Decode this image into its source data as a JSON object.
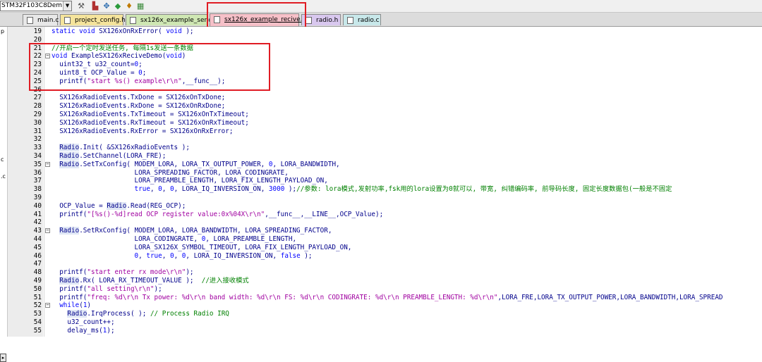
{
  "toolbar": {
    "target": "STM32F103C8Dem",
    "icons": [
      "wand-icon",
      "manage-icon",
      "component-icon",
      "diamond-icon",
      "download-icon",
      "chip-icon"
    ]
  },
  "tabs": [
    {
      "label": "main.c",
      "color": "#e8e8e8",
      "active": false
    },
    {
      "label": "project_config.h",
      "color": "#f5e49c",
      "active": false
    },
    {
      "label": "sx126x_example_send.c",
      "color": "#cfe7b3",
      "active": false
    },
    {
      "label": "sx126x_example_recive.c",
      "color": "#f6c0c8",
      "active": true
    },
    {
      "label": "radio.h",
      "color": "#d9c8ef",
      "active": false
    },
    {
      "label": "radio.c",
      "color": "#c8e8ea",
      "active": false
    }
  ],
  "sidebar": {
    "fragments": [
      "p",
      "c",
      ".c"
    ],
    "scroll_arrow": "▸"
  },
  "code_lines": [
    {
      "n": "19",
      "fold": "",
      "segs": [
        [
          "k",
          "static void "
        ],
        [
          "i",
          "SX126xOnRxError( "
        ],
        [
          "k",
          "void"
        ],
        [
          "i",
          " );"
        ]
      ]
    },
    {
      "n": "20",
      "fold": "",
      "segs": []
    },
    {
      "n": "21",
      "fold": "",
      "segs": [
        [
          "c",
          "//开启一个定时发送任务, 每隔1s发送一条数据"
        ]
      ]
    },
    {
      "n": "22",
      "fold": "⊟",
      "segs": [
        [
          "k",
          "void "
        ],
        [
          "i",
          "ExampleSX126xReciveDemo("
        ],
        [
          "k",
          "void"
        ],
        [
          "i",
          ")"
        ]
      ]
    },
    {
      "n": "23",
      "fold": "",
      "segs": [
        [
          "i",
          "  uint32_t u32_count="
        ],
        [
          "n",
          "0"
        ],
        [
          "i",
          ";"
        ]
      ]
    },
    {
      "n": "24",
      "fold": "",
      "segs": [
        [
          "i",
          "  uint8_t OCP_Value = "
        ],
        [
          "n",
          "0"
        ],
        [
          "i",
          ";"
        ]
      ]
    },
    {
      "n": "25",
      "fold": "",
      "segs": [
        [
          "i",
          "  printf("
        ],
        [
          "s",
          "\"start %s() example\\r\\n\""
        ],
        [
          "i",
          ",__func__);"
        ]
      ]
    },
    {
      "n": "26",
      "fold": "",
      "segs": []
    },
    {
      "n": "27",
      "fold": "",
      "segs": [
        [
          "i",
          "  SX126xRadioEvents.TxDone = SX126xOnTxDone;"
        ]
      ]
    },
    {
      "n": "28",
      "fold": "",
      "segs": [
        [
          "i",
          "  SX126xRadioEvents.RxDone = SX126xOnRxDone;"
        ]
      ]
    },
    {
      "n": "29",
      "fold": "",
      "segs": [
        [
          "i",
          "  SX126xRadioEvents.TxTimeout = SX126xOnTxTimeout;"
        ]
      ]
    },
    {
      "n": "30",
      "fold": "",
      "segs": [
        [
          "i",
          "  SX126xRadioEvents.RxTimeout = SX126xOnRxTimeout;"
        ]
      ]
    },
    {
      "n": "31",
      "fold": "",
      "segs": [
        [
          "i",
          "  SX126xRadioEvents.RxError = SX126xOnRxError;"
        ]
      ]
    },
    {
      "n": "32",
      "fold": "",
      "segs": []
    },
    {
      "n": "33",
      "fold": "",
      "segs": [
        [
          "i",
          "  "
        ],
        [
          "o",
          "Radio"
        ],
        [
          "i",
          ".Init( &SX126xRadioEvents );"
        ]
      ]
    },
    {
      "n": "34",
      "fold": "",
      "segs": [
        [
          "i",
          "  "
        ],
        [
          "o",
          "Radio"
        ],
        [
          "i",
          ".SetChannel(LORA_FRE);"
        ]
      ]
    },
    {
      "n": "35",
      "fold": "⊟",
      "segs": [
        [
          "i",
          "  "
        ],
        [
          "o",
          "Radio"
        ],
        [
          "i",
          ".SetTxConfig( MODEM_LORA, LORA_TX_OUTPUT_POWER, "
        ],
        [
          "n",
          "0"
        ],
        [
          "i",
          ", LORA_BANDWIDTH,"
        ]
      ]
    },
    {
      "n": "36",
      "fold": "",
      "segs": [
        [
          "i",
          "                     LORA_SPREADING_FACTOR, LORA_CODINGRATE,"
        ]
      ]
    },
    {
      "n": "37",
      "fold": "",
      "segs": [
        [
          "i",
          "                     LORA_PREAMBLE_LENGTH, LORA_FIX_LENGTH_PAYLOAD_ON,"
        ]
      ]
    },
    {
      "n": "38",
      "fold": "",
      "segs": [
        [
          "i",
          "                     "
        ],
        [
          "k",
          "true"
        ],
        [
          "i",
          ", "
        ],
        [
          "n",
          "0"
        ],
        [
          "i",
          ", "
        ],
        [
          "n",
          "0"
        ],
        [
          "i",
          ", LORA_IQ_INVERSION_ON, "
        ],
        [
          "n",
          "3000"
        ],
        [
          "i",
          " );"
        ],
        [
          "c",
          "//参数: lora模式,发射功率,fsk用的lora设置为0就可以, 带宽, 纠错编码率, 前导码长度, 固定长度数据包(一般是不固定"
        ]
      ]
    },
    {
      "n": "39",
      "fold": "",
      "segs": []
    },
    {
      "n": "40",
      "fold": "",
      "segs": [
        [
          "i",
          "  OCP_Value = "
        ],
        [
          "o",
          "Radio"
        ],
        [
          "i",
          ".Read(REG_OCP);"
        ]
      ]
    },
    {
      "n": "41",
      "fold": "",
      "segs": [
        [
          "i",
          "  printf("
        ],
        [
          "s",
          "\"[%s()-%d]read OCP register value:0x%04X\\r\\n\""
        ],
        [
          "i",
          ",__func__,__LINE__,OCP_Value);"
        ]
      ]
    },
    {
      "n": "42",
      "fold": "",
      "segs": []
    },
    {
      "n": "43",
      "fold": "⊟",
      "segs": [
        [
          "i",
          "  "
        ],
        [
          "o",
          "Radio"
        ],
        [
          "i",
          ".SetRxConfig( MODEM_LORA, LORA_BANDWIDTH, LORA_SPREADING_FACTOR,"
        ]
      ]
    },
    {
      "n": "44",
      "fold": "",
      "segs": [
        [
          "i",
          "                     LORA_CODINGRATE, "
        ],
        [
          "n",
          "0"
        ],
        [
          "i",
          ", LORA_PREAMBLE_LENGTH,"
        ]
      ]
    },
    {
      "n": "45",
      "fold": "",
      "segs": [
        [
          "i",
          "                     LORA_SX126X_SYMBOL_TIMEOUT, LORA_FIX_LENGTH_PAYLOAD_ON,"
        ]
      ]
    },
    {
      "n": "46",
      "fold": "",
      "segs": [
        [
          "i",
          "                     "
        ],
        [
          "n",
          "0"
        ],
        [
          "i",
          ", "
        ],
        [
          "k",
          "true"
        ],
        [
          "i",
          ", "
        ],
        [
          "n",
          "0"
        ],
        [
          "i",
          ", "
        ],
        [
          "n",
          "0"
        ],
        [
          "i",
          ", LORA_IQ_INVERSION_ON, "
        ],
        [
          "k",
          "false"
        ],
        [
          "i",
          " );"
        ]
      ]
    },
    {
      "n": "47",
      "fold": "",
      "segs": []
    },
    {
      "n": "48",
      "fold": "",
      "segs": [
        [
          "i",
          "  printf("
        ],
        [
          "s",
          "\"start enter rx mode\\r\\n\""
        ],
        [
          "i",
          ");"
        ]
      ]
    },
    {
      "n": "49",
      "fold": "",
      "segs": [
        [
          "i",
          "  "
        ],
        [
          "o",
          "Radio"
        ],
        [
          "i",
          ".Rx( LORA_RX_TIMEOUT_VALUE );  "
        ],
        [
          "c",
          "//进入接收模式"
        ]
      ]
    },
    {
      "n": "50",
      "fold": "",
      "segs": [
        [
          "i",
          "  printf("
        ],
        [
          "s",
          "\"all setting\\r\\n\""
        ],
        [
          "i",
          ");"
        ]
      ]
    },
    {
      "n": "51",
      "fold": "",
      "segs": [
        [
          "i",
          "  printf("
        ],
        [
          "s",
          "\"freq: %d\\r\\n Tx power: %d\\r\\n band width: %d\\r\\n FS: %d\\r\\n CODINGRATE: %d\\r\\n PREAMBLE_LENGTH: %d\\r\\n\""
        ],
        [
          "i",
          ",LORA_FRE,LORA_TX_OUTPUT_POWER,LORA_BANDWIDTH,LORA_SPREAD"
        ]
      ]
    },
    {
      "n": "52",
      "fold": "⊟",
      "segs": [
        [
          "i",
          "  "
        ],
        [
          "k",
          "while"
        ],
        [
          "i",
          "("
        ],
        [
          "n",
          "1"
        ],
        [
          "i",
          ")"
        ]
      ]
    },
    {
      "n": "53",
      "fold": "",
      "segs": [
        [
          "i",
          "    "
        ],
        [
          "o",
          "Radio"
        ],
        [
          "i",
          ".IrqProcess( ); "
        ],
        [
          "c",
          "// Process Radio IRQ"
        ]
      ]
    },
    {
      "n": "54",
      "fold": "",
      "segs": [
        [
          "i",
          "    u32_count++;"
        ]
      ]
    },
    {
      "n": "55",
      "fold": "",
      "segs": [
        [
          "i",
          "    delay_ms("
        ],
        [
          "n",
          "1"
        ],
        [
          "i",
          ");"
        ]
      ]
    }
  ]
}
